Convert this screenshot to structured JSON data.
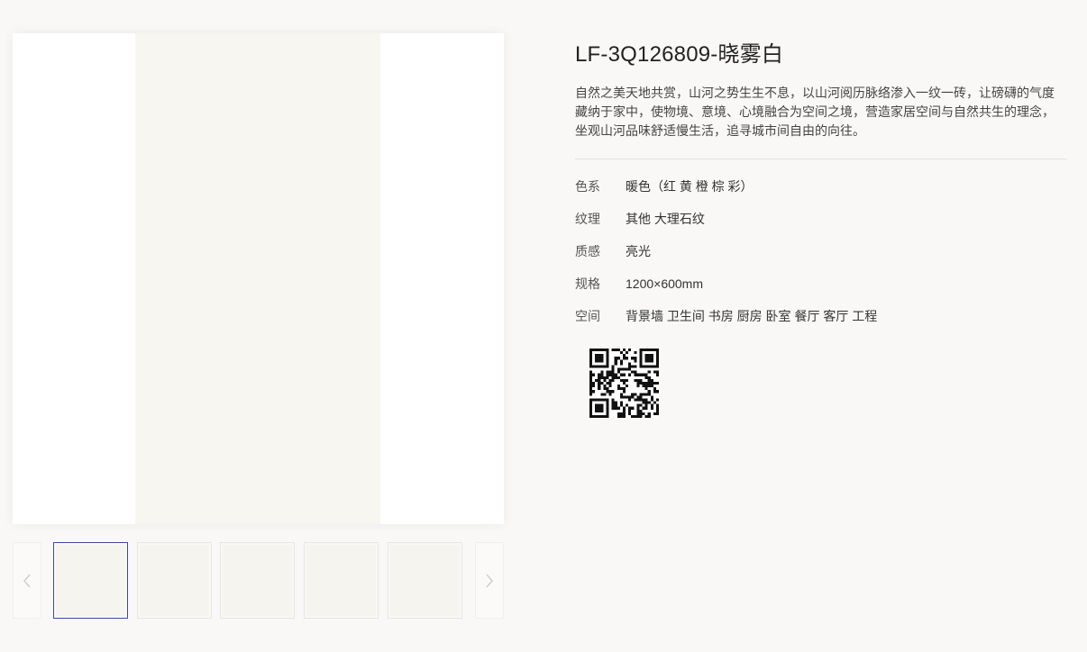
{
  "product": {
    "title": "LF-3Q126809-晓雾白",
    "description": "自然之美天地共赏，山河之势生生不息，以山河阅历脉络渗入一纹一砖，让磅礴的气度藏纳于家中，使物境、意境、心境融合为空间之境，营造家居空间与自然共生的理念，坐观山河品味舒适慢生活，追寻城市间自由的向往。"
  },
  "specs": [
    {
      "label": "色系",
      "value": "暖色（红 黄 橙 棕 彩）"
    },
    {
      "label": "纹理",
      "value": "其他 大理石纹"
    },
    {
      "label": "质感",
      "value": "亮光"
    },
    {
      "label": "规格",
      "value": "1200×600mm"
    },
    {
      "label": "空间",
      "value": "背景墙 卫生间 书房 厨房 卧室 餐厅 客厅 工程"
    }
  ],
  "gallery": {
    "thumbnail_count": 5,
    "active_index": 0
  },
  "icons": {
    "prev": "chevron-left-icon",
    "next": "chevron-right-icon",
    "qr": "qr-code-icon"
  },
  "colors": {
    "background": "#f9f8f6",
    "tile": "#f8f6f1",
    "active_border": "#3d4aa0"
  }
}
